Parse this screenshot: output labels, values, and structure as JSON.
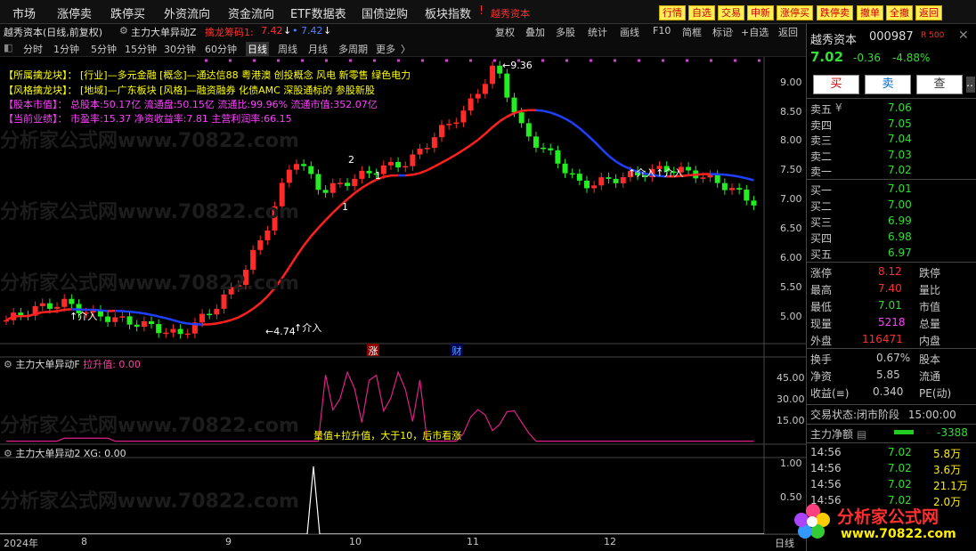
{
  "menubar": {
    "items": [
      "市场",
      "涨停卖",
      "跌停买",
      "外资流向",
      "资金流向",
      "ETF数据表",
      "国债逆购",
      "板块指数"
    ],
    "brand_mark": "!",
    "brand": "越秀资本",
    "buttons": [
      "行情",
      "自选",
      "交易",
      "申新",
      "涨停买",
      "跌停卖",
      "撤单",
      "全撤",
      "返回"
    ]
  },
  "subbar": {
    "stock": "越秀资本(日线,前复权)",
    "indicator": "主力大单异动Z",
    "param_label": "擒龙筹码1:",
    "param_value": "7.42",
    "param2": "7.42",
    "tools": [
      "复权",
      "叠加",
      "多股",
      "统计",
      "画线",
      "F10",
      "简框",
      "标记",
      "+自选",
      "返回"
    ]
  },
  "periods": [
    "分时",
    "1分钟",
    "5分钟",
    "15分钟",
    "30分钟",
    "60分钟",
    "日线",
    "周线",
    "月线",
    "多周期",
    "更多"
  ],
  "info_lines": [
    {
      "label": "【所属擒龙块】：",
      "text": "[行业]—多元金融 [概念]—通达信88 粤港澳 创投概念 风电 新零售 绿色电力"
    },
    {
      "label": "【风格擒龙块】：",
      "text": "[地域]—广东板块 [风格]—融资融券 化债AMC 深股通标的 参股新股"
    },
    {
      "label": "【股本市值】：",
      "text": "总股本:50.17亿 流通盘:50.15亿 流通比:99.96% 流通市值:352.07亿"
    },
    {
      "label": "【当前业绩】：",
      "text": "市盈率:15.37 净资收益率:7.81 主营利润率:66.15"
    }
  ],
  "chart_marks": {
    "high": "9.36",
    "low": "4.74",
    "entry1": "介入",
    "entry2": "介入",
    "entry3": "介入",
    "label1": "1",
    "label2": "2",
    "label1b": "1",
    "zhang": "涨",
    "cai": "财"
  },
  "price_axis": [
    "9.00",
    "8.50",
    "8.00",
    "7.50",
    "7.00",
    "6.50",
    "6.00",
    "5.50",
    "5.00"
  ],
  "sub1": {
    "title": "主力大单异动F",
    "label": "拉升值:",
    "value": "0.00",
    "axis": [
      "45.00",
      "30.00",
      "15.00"
    ],
    "note": "量值+拉升值，大于10，后市看涨"
  },
  "sub2": {
    "title": "主力大单异动2",
    "label": "XG:",
    "value": "0.00",
    "axis": [
      "1.00",
      "0.50"
    ]
  },
  "time_axis": [
    "2024年",
    "8",
    "9",
    "10",
    "11",
    "12",
    "日线"
  ],
  "watermark": "分析家公式网www.70822.com",
  "right": {
    "name": "越秀资本",
    "code": "000987",
    "tag": "R 500",
    "price": "7.02",
    "change": "-0.36",
    "pct": "-4.88%",
    "btn_buy": "买",
    "btn_sell": "卖",
    "btn_query": "查",
    "asks": [
      {
        "l": "卖五",
        "p": "7.06"
      },
      {
        "l": "卖四",
        "p": "7.05"
      },
      {
        "l": "卖三",
        "p": "7.04"
      },
      {
        "l": "卖二",
        "p": "7.03"
      },
      {
        "l": "卖一",
        "p": "7.02"
      }
    ],
    "bids": [
      {
        "l": "买一",
        "p": "7.01"
      },
      {
        "l": "买二",
        "p": "7.00"
      },
      {
        "l": "买三",
        "p": "6.99"
      },
      {
        "l": "买四",
        "p": "6.98"
      },
      {
        "l": "买五",
        "p": "6.97"
      }
    ],
    "stats": [
      {
        "l": "涨停",
        "v": "8.12",
        "r": "跌停"
      },
      {
        "l": "最高",
        "v": "7.40",
        "r": "量比"
      },
      {
        "l": "最低",
        "v": "7.01",
        "r": "市值"
      },
      {
        "l": "现量",
        "v": "5218",
        "r": "总量"
      },
      {
        "l": "外盘",
        "v": "116471",
        "r": "内盘"
      }
    ],
    "stats2": [
      {
        "l": "换手",
        "v": "0.67%",
        "r": "股本"
      },
      {
        "l": "净资",
        "v": "5.85",
        "r": "流通"
      },
      {
        "l": "收益(≡)",
        "v": "0.340",
        "r": "PE(动)"
      }
    ],
    "status_label": "交易状态:",
    "status": "闭市阶段",
    "status_time": "15:00:00",
    "net_label": "主力净额",
    "net_value": "-3388",
    "ticks": [
      {
        "t": "14:56",
        "p": "7.02",
        "v": "5.8万"
      },
      {
        "t": "14:56",
        "p": "7.02",
        "v": "3.6万"
      },
      {
        "t": "14:56",
        "p": "7.02",
        "v": "21.1万"
      },
      {
        "t": "14:56",
        "p": "7.02",
        "v": "2.0万"
      }
    ]
  },
  "logo": {
    "name": "分析家公式网",
    "url": "www.70822.com"
  },
  "chart_data": {
    "type": "candlestick",
    "title": "越秀资本(日线,前复权)",
    "ylim": [
      4.6,
      9.5
    ],
    "ohlc_approx": [
      5.0,
      5.2,
      5.3,
      5.1,
      5.0,
      4.9,
      4.74,
      5.1,
      5.6,
      6.5,
      7.8,
      7.2,
      7.4,
      7.6,
      7.7,
      8.2,
      8.6,
      9.36,
      8.2,
      7.8,
      7.3,
      7.4,
      7.5,
      7.6,
      7.5,
      7.3,
      7.02
    ]
  }
}
